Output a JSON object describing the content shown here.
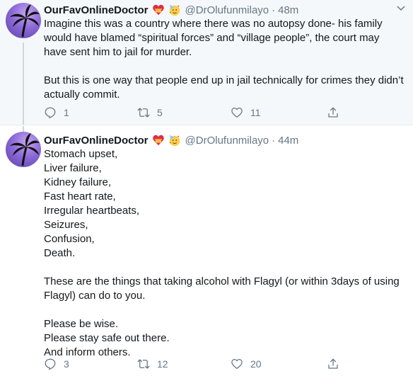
{
  "tweets": [
    {
      "display_name": "OurFavOnlineDoctor",
      "handle": "@DrOlufunmilayo",
      "separator": "·",
      "time": "48m",
      "text": "Imagine this was a country where there was no autopsy done- his family would have blamed “spiritual forces” and “village people”, the court may have sent him to jail for murder.\n\nBut this is one way that people end up in jail technically for crimes they didn’t actually commit.",
      "replies": "1",
      "retweets": "5",
      "likes": "11"
    },
    {
      "display_name": "OurFavOnlineDoctor",
      "handle": "@DrOlufunmilayo",
      "separator": "·",
      "time": "44m",
      "text": "Stomach upset,\nLiver failure,\nKidney failure,\nFast heart rate,\nIrregular heartbeats,\nSeizures,\nConfusion,\nDeath.\n\nThese are the things that taking alcohol with Flagyl (or within 3days of using Flagyl) can do to you.\n\nPlease be wise.\nPlease stay safe out there.\nAnd inform others.",
      "replies": "3",
      "retweets": "12",
      "likes": "20"
    }
  ],
  "icons": {
    "badge1": "heart-with-ribbon-emoji",
    "badge2": "partying-face-emoji",
    "reply": "reply-icon",
    "retweet": "retweet-icon",
    "like": "heart-icon",
    "share": "share-icon",
    "menu": "chevron-down-icon"
  },
  "colors": {
    "text": "#14171a",
    "secondary": "#657786",
    "highlight_bg": "#f5f8fa",
    "thread_line": "#ccd6dd"
  }
}
